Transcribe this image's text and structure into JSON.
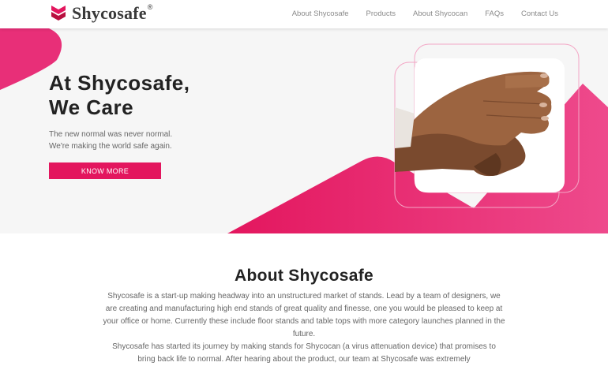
{
  "brand": {
    "name": "Shycosafe",
    "reg_mark": "®"
  },
  "nav": {
    "items": [
      "About Shycosafe",
      "Products",
      "About Shycocan",
      "FAQs",
      "Contact Us"
    ]
  },
  "hero": {
    "title_line1": "At Shycosafe,",
    "title_line2": "We Care",
    "subtitle_line1": "The new normal was never normal.",
    "subtitle_line2": "We're making the world safe again.",
    "cta_label": "KNOW MORE"
  },
  "about": {
    "title": "About Shycosafe",
    "paragraph1": "Shycosafe is a start-up making headway into an unstructured market of stands. Lead by a team of designers, we are creating and manufacturing high end stands of great quality and finesse, one you would be pleased to keep at your office or home. Currently these include floor stands and table tops with more category launches planned in the future.",
    "paragraph2": "Shycosafe has started its journey by making stands for Shycocan (a virus attenuation device) that promises to bring back life to normal. After hearing about the product, our team at Shycosafe was extremely"
  },
  "colors": {
    "accent": "#e3165e",
    "accent_light": "#ef4d8f"
  }
}
